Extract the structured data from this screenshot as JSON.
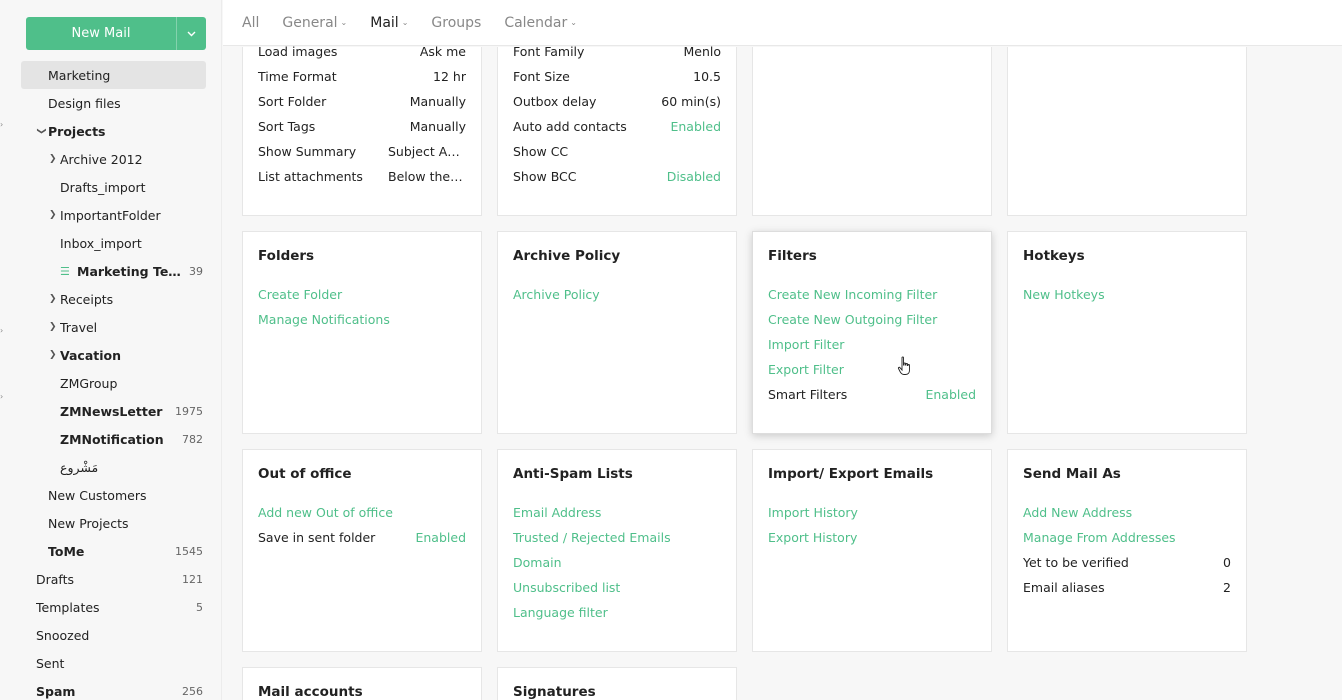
{
  "compose": {
    "label": "New Mail"
  },
  "sidebar": {
    "items": [
      {
        "label": "Marketing",
        "count": ""
      },
      {
        "label": "Design files",
        "count": ""
      },
      {
        "label": "Projects",
        "count": ""
      },
      {
        "label": "Archive 2012",
        "count": ""
      },
      {
        "label": "Drafts_import",
        "count": ""
      },
      {
        "label": "ImportantFolder",
        "count": ""
      },
      {
        "label": "Inbox_import",
        "count": ""
      },
      {
        "label": "Marketing Team",
        "count": "39"
      },
      {
        "label": "Receipts",
        "count": ""
      },
      {
        "label": "Travel",
        "count": ""
      },
      {
        "label": "Vacation",
        "count": ""
      },
      {
        "label": "ZMGroup",
        "count": ""
      },
      {
        "label": "ZMNewsLetter",
        "count": "1975"
      },
      {
        "label": "ZMNotification",
        "count": "782"
      },
      {
        "label": "مَشْروع",
        "count": ""
      },
      {
        "label": "New Customers",
        "count": ""
      },
      {
        "label": "New Projects",
        "count": ""
      },
      {
        "label": "ToMe",
        "count": "1545"
      },
      {
        "label": "Drafts",
        "count": "121"
      },
      {
        "label": "Templates",
        "count": "5"
      },
      {
        "label": "Snoozed",
        "count": ""
      },
      {
        "label": "Sent",
        "count": ""
      },
      {
        "label": "Spam",
        "count": "256"
      }
    ]
  },
  "nav": {
    "tabs": [
      {
        "label": "All"
      },
      {
        "label": "General"
      },
      {
        "label": "Mail"
      },
      {
        "label": "Groups"
      },
      {
        "label": "Calendar"
      }
    ]
  },
  "cards": {
    "general": {
      "rows": [
        {
          "k": "Load images",
          "v": "Ask me"
        },
        {
          "k": "Time Format",
          "v": "12 hr"
        },
        {
          "k": "Sort Folder",
          "v": "Manually"
        },
        {
          "k": "Sort Tags",
          "v": "Manually"
        },
        {
          "k": "Show Summary",
          "v": "Subject And Summary"
        },
        {
          "k": "List attachments",
          "v": "Below the Email"
        }
      ]
    },
    "compose": {
      "rows": [
        {
          "k": "Font Family",
          "v": "Menlo"
        },
        {
          "k": "Font Size",
          "v": "10.5"
        },
        {
          "k": "Outbox delay",
          "v": "60 min(s)"
        },
        {
          "k": "Auto add contacts",
          "v": "Enabled"
        },
        {
          "k": "Show CC",
          "v": ""
        },
        {
          "k": "Show BCC",
          "v": "Disabled"
        }
      ]
    },
    "folders": {
      "title": "Folders",
      "links": [
        "Create Folder",
        "Manage Notifications"
      ]
    },
    "archive": {
      "title": "Archive Policy",
      "links": [
        "Archive Policy"
      ]
    },
    "filters": {
      "title": "Filters",
      "links": [
        "Create New Incoming Filter",
        "Create New Outgoing Filter",
        "Import Filter",
        "Export Filter"
      ],
      "smart": {
        "k": "Smart Filters",
        "v": "Enabled"
      }
    },
    "hotkeys": {
      "title": "Hotkeys",
      "links": [
        "New Hotkeys"
      ]
    },
    "ooo": {
      "title": "Out of office",
      "links": [
        "Add new Out of office"
      ],
      "row": {
        "k": "Save in sent folder",
        "v": "Enabled"
      }
    },
    "antispam": {
      "title": "Anti-Spam Lists",
      "links": [
        "Email Address",
        "Trusted / Rejected Emails",
        "Domain",
        "Unsubscribed list",
        "Language filter"
      ]
    },
    "importexport": {
      "title": "Import/ Export Emails",
      "links": [
        "Import History",
        "Export History"
      ]
    },
    "sendas": {
      "title": "Send Mail As",
      "links": [
        "Add New Address",
        "Manage From Addresses"
      ],
      "rows": [
        {
          "k": "Yet to be verified",
          "v": "0"
        },
        {
          "k": "Email aliases",
          "v": "2"
        }
      ]
    },
    "mailaccounts": {
      "title": "Mail accounts"
    },
    "signatures": {
      "title": "Signatures"
    }
  }
}
